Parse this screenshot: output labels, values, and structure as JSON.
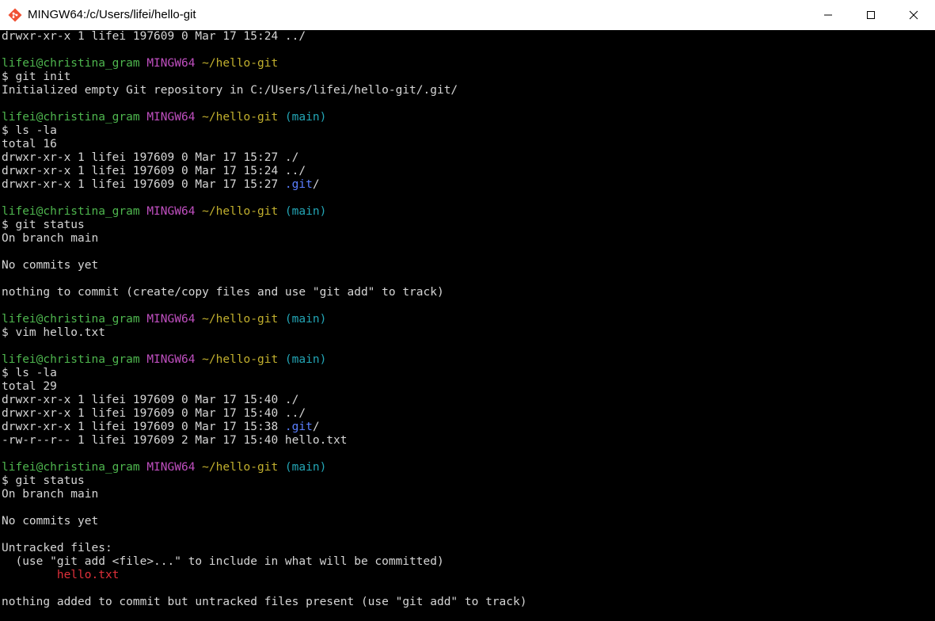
{
  "window": {
    "title": "MINGW64:/c/Users/lifei/hello-git",
    "icons": {
      "app": "git-bash-icon",
      "minimize": "minimize-icon",
      "maximize": "maximize-icon",
      "close": "close-icon"
    }
  },
  "colors": {
    "background": "#000000",
    "text": "#d6d6d6",
    "user_host": "#4eb64e",
    "mingw": "#c04fc0",
    "path": "#c2b02e",
    "branch": "#23a6b6",
    "directory": "#5b7fff",
    "untracked": "#e0303a"
  },
  "terminal": {
    "lines": [
      {
        "segments": [
          {
            "text": "drwxr-xr-x 1 lifei 197609 0 Mar 17 15:24 ../",
            "color": ""
          }
        ]
      },
      {
        "segments": []
      },
      {
        "segments": [
          {
            "text": "lifei@christina_gram ",
            "color": "green"
          },
          {
            "text": "MINGW64 ",
            "color": "purple"
          },
          {
            "text": "~/hello-git",
            "color": "yellow"
          }
        ]
      },
      {
        "segments": [
          {
            "text": "$ git init",
            "color": ""
          }
        ]
      },
      {
        "segments": [
          {
            "text": "Initialized empty Git repository in C:/Users/lifei/hello-git/.git/",
            "color": ""
          }
        ]
      },
      {
        "segments": []
      },
      {
        "segments": [
          {
            "text": "lifei@christina_gram ",
            "color": "green"
          },
          {
            "text": "MINGW64 ",
            "color": "purple"
          },
          {
            "text": "~/hello-git",
            "color": "yellow"
          },
          {
            "text": " (main)",
            "color": "cyan"
          }
        ]
      },
      {
        "segments": [
          {
            "text": "$ ls -la",
            "color": ""
          }
        ]
      },
      {
        "segments": [
          {
            "text": "total 16",
            "color": ""
          }
        ]
      },
      {
        "segments": [
          {
            "text": "drwxr-xr-x 1 lifei 197609 0 Mar 17 15:27 ./",
            "color": ""
          }
        ]
      },
      {
        "segments": [
          {
            "text": "drwxr-xr-x 1 lifei 197609 0 Mar 17 15:24 ../",
            "color": ""
          }
        ]
      },
      {
        "segments": [
          {
            "text": "drwxr-xr-x 1 lifei 197609 0 Mar 17 15:27 ",
            "color": ""
          },
          {
            "text": ".git",
            "color": "blue"
          },
          {
            "text": "/",
            "color": ""
          }
        ]
      },
      {
        "segments": []
      },
      {
        "segments": [
          {
            "text": "lifei@christina_gram ",
            "color": "green"
          },
          {
            "text": "MINGW64 ",
            "color": "purple"
          },
          {
            "text": "~/hello-git",
            "color": "yellow"
          },
          {
            "text": " (main)",
            "color": "cyan"
          }
        ]
      },
      {
        "segments": [
          {
            "text": "$ git status",
            "color": ""
          }
        ]
      },
      {
        "segments": [
          {
            "text": "On branch main",
            "color": ""
          }
        ]
      },
      {
        "segments": []
      },
      {
        "segments": [
          {
            "text": "No commits yet",
            "color": ""
          }
        ]
      },
      {
        "segments": []
      },
      {
        "segments": [
          {
            "text": "nothing to commit (create/copy files and use \"git add\" to track)",
            "color": ""
          }
        ]
      },
      {
        "segments": []
      },
      {
        "segments": [
          {
            "text": "lifei@christina_gram ",
            "color": "green"
          },
          {
            "text": "MINGW64 ",
            "color": "purple"
          },
          {
            "text": "~/hello-git",
            "color": "yellow"
          },
          {
            "text": " (main)",
            "color": "cyan"
          }
        ]
      },
      {
        "segments": [
          {
            "text": "$ vim hello.txt",
            "color": ""
          }
        ]
      },
      {
        "segments": []
      },
      {
        "segments": [
          {
            "text": "lifei@christina_gram ",
            "color": "green"
          },
          {
            "text": "MINGW64 ",
            "color": "purple"
          },
          {
            "text": "~/hello-git",
            "color": "yellow"
          },
          {
            "text": " (main)",
            "color": "cyan"
          }
        ]
      },
      {
        "segments": [
          {
            "text": "$ ls -la",
            "color": ""
          }
        ]
      },
      {
        "segments": [
          {
            "text": "total 29",
            "color": ""
          }
        ]
      },
      {
        "segments": [
          {
            "text": "drwxr-xr-x 1 lifei 197609 0 Mar 17 15:40 ./",
            "color": ""
          }
        ]
      },
      {
        "segments": [
          {
            "text": "drwxr-xr-x 1 lifei 197609 0 Mar 17 15:40 ../",
            "color": ""
          }
        ]
      },
      {
        "segments": [
          {
            "text": "drwxr-xr-x 1 lifei 197609 0 Mar 17 15:38 ",
            "color": ""
          },
          {
            "text": ".git",
            "color": "blue"
          },
          {
            "text": "/",
            "color": ""
          }
        ]
      },
      {
        "segments": [
          {
            "text": "-rw-r--r-- 1 lifei 197609 2 Mar 17 15:40 hello.txt",
            "color": ""
          }
        ]
      },
      {
        "segments": []
      },
      {
        "segments": [
          {
            "text": "lifei@christina_gram ",
            "color": "green"
          },
          {
            "text": "MINGW64 ",
            "color": "purple"
          },
          {
            "text": "~/hello-git",
            "color": "yellow"
          },
          {
            "text": " (main)",
            "color": "cyan"
          }
        ]
      },
      {
        "segments": [
          {
            "text": "$ git status",
            "color": ""
          }
        ]
      },
      {
        "segments": [
          {
            "text": "On branch main",
            "color": ""
          }
        ]
      },
      {
        "segments": []
      },
      {
        "segments": [
          {
            "text": "No commits yet",
            "color": ""
          }
        ]
      },
      {
        "segments": []
      },
      {
        "segments": [
          {
            "text": "Untracked files:",
            "color": ""
          }
        ]
      },
      {
        "segments": [
          {
            "text": "  (use \"git add <file>...\" to include in what will be committed)",
            "color": ""
          }
        ]
      },
      {
        "segments": [
          {
            "text": "        ",
            "color": ""
          },
          {
            "text": "hello.txt",
            "color": "red"
          }
        ]
      },
      {
        "segments": []
      },
      {
        "segments": [
          {
            "text": "nothing added to commit but untracked files present (use \"git add\" to track)",
            "color": ""
          }
        ]
      }
    ]
  }
}
